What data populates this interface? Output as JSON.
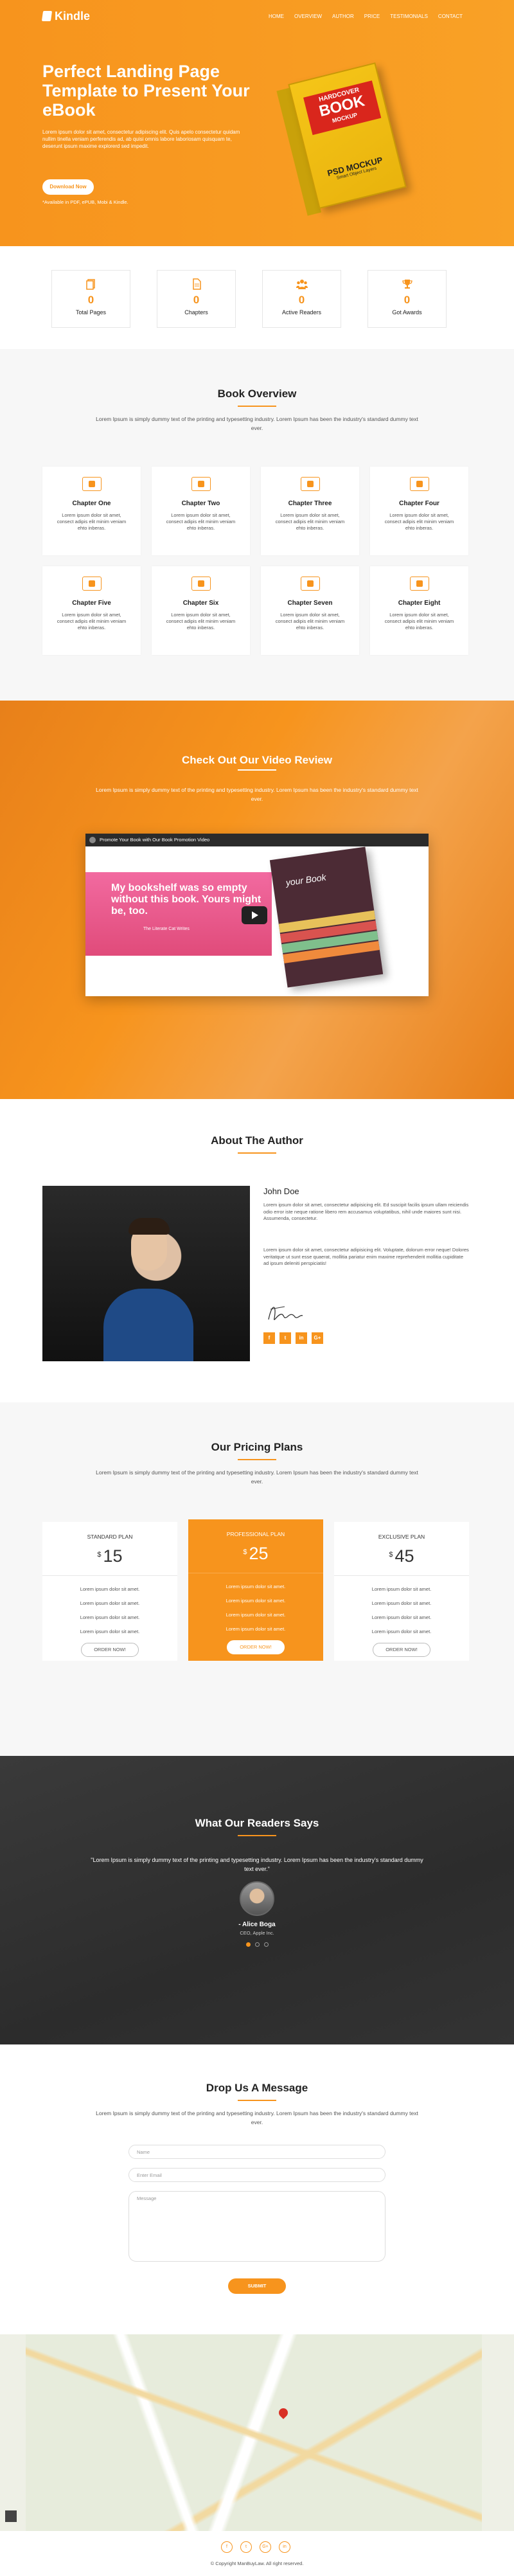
{
  "nav": {
    "logo": "Kindle",
    "menu": [
      "HOME",
      "OVERVIEW",
      "AUTHOR",
      "PRICE",
      "TESTIMONIALS",
      "CONTACT"
    ]
  },
  "hero": {
    "title": "Perfect Landing Page Template to Present Your eBook",
    "desc": "Lorem ipsum dolor sit amet, consectetur adipiscing elit. Quis apelo consectetur quidam nullim tinella veniam perferendis ad, ab quisi omnis labore laboriosam quisquam te, deserunt ipsum maxime explorerd sed impedit.",
    "button": "Download Now",
    "available": "*Available in PDF, ePUB, Mobi & Kindle.",
    "book": {
      "line1": "HARDCOVER",
      "line2": "BOOK",
      "line3": "MOCKUP",
      "psd": "PSD MOCKUP",
      "psd_sub": "Smart Object Layers"
    }
  },
  "stats": [
    {
      "icon": "pages-icon",
      "value": "0",
      "label": "Total Pages"
    },
    {
      "icon": "document-icon",
      "value": "0",
      "label": "Chapters"
    },
    {
      "icon": "users-icon",
      "value": "0",
      "label": "Active Readers"
    },
    {
      "icon": "trophy-icon",
      "value": "0",
      "label": "Got Awards"
    }
  ],
  "overview": {
    "title": "Book Overview",
    "sub": "Lorem Ipsum is simply dummy text of the printing and typesetting industry. Lorem Ipsum has been the industry's standard dummy text ever.",
    "chapters": [
      {
        "title": "Chapter One",
        "desc": "Lorem ipsum dolor sit amet, consect adipis elit minim veniam ehto inberas."
      },
      {
        "title": "Chapter Two",
        "desc": "Lorem ipsum dolor sit amet, consect adipis elit minim veniam ehto inberas."
      },
      {
        "title": "Chapter Three",
        "desc": "Lorem ipsum dolor sit amet, consect adipis elit minim veniam ehto inberas."
      },
      {
        "title": "Chapter Four",
        "desc": "Lorem ipsum dolor sit amet, consect adipis elit minim veniam ehto inberas."
      },
      {
        "title": "Chapter Five",
        "desc": "Lorem ipsum dolor sit amet, consect adipis elit minim veniam ehto inberas."
      },
      {
        "title": "Chapter Six",
        "desc": "Lorem ipsum dolor sit amet, consect adipis elit minim veniam ehto inberas."
      },
      {
        "title": "Chapter Seven",
        "desc": "Lorem ipsum dolor sit amet, consect adipis elit minim veniam ehto inberas."
      },
      {
        "title": "Chapter Eight",
        "desc": "Lorem ipsum dolor sit amet, consect adipis elit minim veniam ehto inberas."
      }
    ]
  },
  "video": {
    "title": "Check Out Our Video Review",
    "sub": "Lorem Ipsum is simply dummy text of the printing and typesetting industry. Lorem Ipsum has been the industry's standard dummy text ever.",
    "player_title": "Promote Your Book with Our Book Promotion Video",
    "quote": "My bookshelf was so empty without this book. Yours might be, too.",
    "quote_by": "The Literate Cat Writes",
    "book_title": "your Book"
  },
  "author": {
    "title": "About The Author",
    "name": "John Doe",
    "p1": "Lorem ipsum dolor sit amet, consectetur adipisicing elit. Ed suscipit facilis ipsum ullam reiciendis odio error iste neque ratione libero rem accusamus voluptatibus, nihil unde maiores sunt nisi. Assumenda, consectetur.",
    "p2": "Lorem ipsum dolor sit amet, consectetur adipisicing elit. Voluptate, dolorum error neque! Dolores veritatque ut sunt esse quaerat, mollitia pariatur enim maxime reprehenderit mollitia cupiditate ad ipsum deleniti perspiciatis!",
    "socials": [
      "f",
      "t",
      "in",
      "G+"
    ]
  },
  "pricing": {
    "title": "Our Pricing Plans",
    "sub": "Lorem Ipsum is simply dummy text of the printing and typesetting industry. Lorem Ipsum has been the industry's standard dummy text ever.",
    "plans": [
      {
        "name": "STANDARD PLAN",
        "currency": "$",
        "price": "15",
        "features": [
          "Lorem ipsum dolor sit amet.",
          "Lorem ipsum dolor sit amet.",
          "Lorem ipsum dolor sit amet.",
          "Lorem ipsum dolor sit amet."
        ],
        "button": "ORDER NOW!"
      },
      {
        "name": "PROFESSIONAL PLAN",
        "currency": "$",
        "price": "25",
        "features": [
          "Lorem ipsum dolor sit amet.",
          "Lorem ipsum dolor sit amet.",
          "Lorem ipsum dolor sit amet.",
          "Lorem ipsum dolor sit amet."
        ],
        "button": "ORDER NOW!"
      },
      {
        "name": "EXCLUSIVE PLAN",
        "currency": "$",
        "price": "45",
        "features": [
          "Lorem ipsum dolor sit amet.",
          "Lorem ipsum dolor sit amet.",
          "Lorem ipsum dolor sit amet.",
          "Lorem ipsum dolor sit amet."
        ],
        "button": "ORDER NOW!"
      }
    ]
  },
  "testimonials": {
    "title": "What Our Readers Says",
    "quote": "\"Lorem Ipsum is simply dummy text of the printing and typesetting industry. Lorem Ipsum has been the industry's standard dummy text ever.\"",
    "name": "- Alice Boga",
    "role": "CEO, Apple Inc."
  },
  "contact": {
    "title": "Drop Us A Message",
    "sub": "Lorem Ipsum is simply dummy text of the printing and typesetting industry. Lorem Ipsum has been the industry's standard dummy text ever.",
    "name_placeholder": "Name",
    "email_placeholder": "Enter Email",
    "message_placeholder": "Message",
    "submit": "SUBMIT"
  },
  "footer": {
    "icons": [
      "f",
      "t",
      "G+",
      "in"
    ],
    "copyright": "© Copyright ManBuyLaw. All right reserved."
  },
  "colors": {
    "accent": "#f7941d",
    "dark": "#333333"
  }
}
